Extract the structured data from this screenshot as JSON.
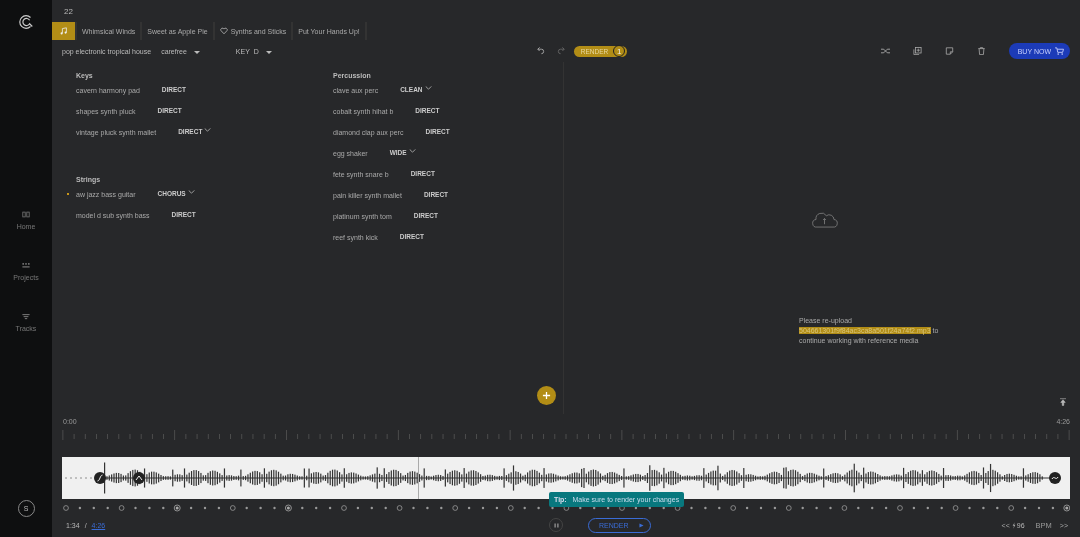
{
  "sidebar": {
    "nav": [
      {
        "label": "Home",
        "kind": "home",
        "selected": false
      },
      {
        "label": "Projects",
        "kind": "projects",
        "selected": false
      },
      {
        "label": "Tracks",
        "kind": "tracks",
        "selected": false
      }
    ],
    "avatar": "S"
  },
  "header": {
    "number": "22"
  },
  "tabs": [
    {
      "kind": "note",
      "selected": true
    },
    {
      "label": "Whimsical Winds",
      "kind": "plain",
      "selected": false
    },
    {
      "label": "Sweet as Apple Pie",
      "kind": "plain",
      "selected": false
    },
    {
      "label": "Synths and Sticks",
      "kind": "heart",
      "selected": false
    },
    {
      "label": "Put Your Hands Up!",
      "kind": "plain",
      "selected": false
    }
  ],
  "meta": {
    "genre": "pop electronic tropical house",
    "mood": "carefree",
    "key_label": "KEY",
    "key": "D"
  },
  "toolbar": {
    "render_label": "RENDER",
    "render_count": "1",
    "buy_label": "BUY NOW"
  },
  "instruments": [
    [
      {
        "title": "Keys",
        "items": [
          {
            "name": "cavern harmony pad",
            "effect": "DIRECT",
            "dropdown": false,
            "active": false
          },
          {
            "name": "shapes synth pluck",
            "effect": "DIRECT",
            "dropdown": false,
            "active": false
          },
          {
            "name": "vintage pluck synth mallet",
            "effect": "DIRECT",
            "dropdown": true,
            "active": false
          }
        ]
      },
      {
        "title": "Strings",
        "items": [
          {
            "name": "aw jazz bass guitar",
            "effect": "CHORUS",
            "dropdown": true,
            "active": true
          },
          {
            "name": "model d sub synth bass",
            "effect": "DIRECT",
            "dropdown": false,
            "active": false
          }
        ]
      }
    ],
    [
      {
        "title": "Percussion",
        "items": [
          {
            "name": "clave aux perc",
            "effect": "CLEAN",
            "dropdown": true,
            "active": false
          },
          {
            "name": "cobalt synth hihat b",
            "effect": "DIRECT",
            "dropdown": false,
            "active": false
          },
          {
            "name": "diamond clap aux perc",
            "effect": "DIRECT",
            "dropdown": false,
            "active": false
          },
          {
            "name": "egg shaker",
            "effect": "WIDE",
            "dropdown": true,
            "active": false
          },
          {
            "name": "fete synth snare b",
            "effect": "DIRECT",
            "dropdown": false,
            "active": false
          },
          {
            "name": "pain killer synth mallet",
            "effect": "DIRECT",
            "dropdown": false,
            "active": false
          },
          {
            "name": "platinum synth tom",
            "effect": "DIRECT",
            "dropdown": false,
            "active": false
          },
          {
            "name": "reef synth kick",
            "effect": "DIRECT",
            "dropdown": false,
            "active": false
          }
        ]
      }
    ]
  ],
  "reference": {
    "before": "Please re-upload",
    "file": "504661301f9f84ac3ca8a501f24a74f2.mp3",
    "after": "to continue working with reference media"
  },
  "timeline": {
    "start": "0:00",
    "end": "4:26"
  },
  "playback": {
    "level": 0.353,
    "playing": true,
    "current": "1:34",
    "separator": "/",
    "total": "4:26",
    "render_label": "RENDER",
    "tip_label": "Tip:",
    "tip_text": "Make sure to render your changes",
    "prev": "<<",
    "tempo": "96",
    "bpm_label": "BPM",
    "next": ">>"
  }
}
